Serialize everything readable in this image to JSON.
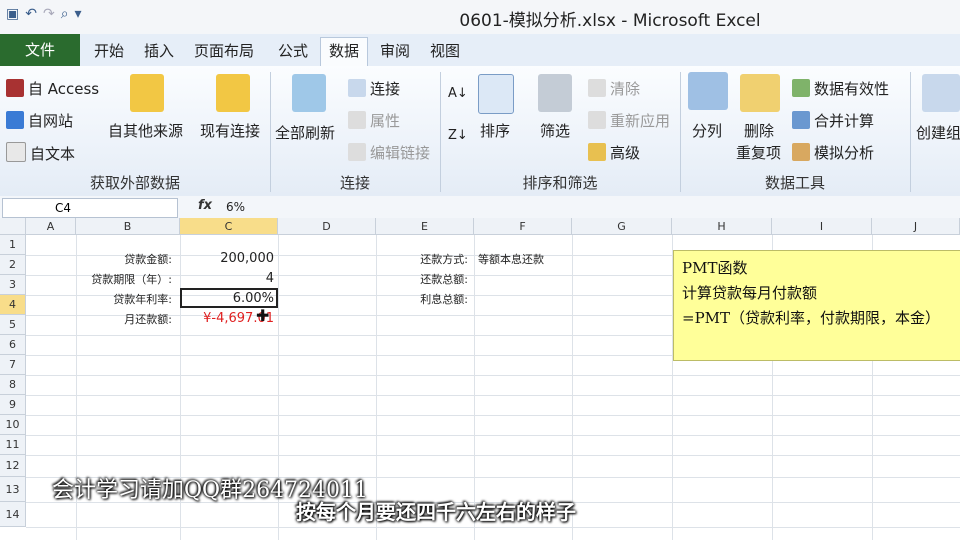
{
  "window": {
    "title": "0601-模拟分析.xlsx - Microsoft Excel"
  },
  "tabs": [
    "文件",
    "开始",
    "插入",
    "页面布局",
    "公式",
    "数据",
    "审阅",
    "视图"
  ],
  "ribbon": {
    "get_external": {
      "access": "自 Access",
      "web": "自网站",
      "text": "自文本",
      "other": "自其他来源",
      "existing": "现有连接",
      "label": "获取外部数据"
    },
    "connections": {
      "refresh_all": "全部刷新",
      "connections": "连接",
      "properties": "属性",
      "edit_links": "编辑链接",
      "label": "连接"
    },
    "sort_filter": {
      "sort": "排序",
      "filter": "筛选",
      "clear": "清除",
      "reapply": "重新应用",
      "advanced": "高级",
      "label": "排序和筛选"
    },
    "data_tools": {
      "split": "分列",
      "remove_dup_1": "删除",
      "remove_dup_2": "重复项",
      "validation": "数据有效性",
      "consolidate": "合并计算",
      "what_if": "模拟分析",
      "label": "数据工具"
    },
    "outline": {
      "group": "创建组"
    }
  },
  "formula_bar": {
    "name_box": "C4",
    "fx": "fx",
    "value": "6%"
  },
  "columns": [
    "A",
    "B",
    "C",
    "D",
    "E",
    "F",
    "G",
    "H",
    "I",
    "J"
  ],
  "rows": [
    "1",
    "2",
    "3",
    "4",
    "5",
    "6",
    "7",
    "8",
    "9",
    "10",
    "11",
    "12",
    "13",
    "14"
  ],
  "cells": {
    "b2": "贷款金额:",
    "c2": "200,000",
    "b3": "贷款期限（年）:",
    "c3": "4",
    "b4": "贷款年利率:",
    "c4": "6.00%",
    "b5": "月还款额:",
    "c5": "¥-4,697.01",
    "e2": "还款方式:",
    "f2": "等额本息还款",
    "e3": "还款总额:",
    "e4": "利息总额:"
  },
  "note": {
    "line1": "PMT函数",
    "line2": "计算贷款每月付款额",
    "line3": "=PMT（贷款利率，付款期限，本金）"
  },
  "captions": {
    "line1": "会计学习请加QQ群264724011",
    "line2": "按每个月要还四千六左右的样子"
  },
  "colors": {
    "file_tab": "#2a6b2e",
    "note_bg": "#ffff99",
    "negative": "#e02020",
    "selected_header": "#f8dd8a"
  }
}
